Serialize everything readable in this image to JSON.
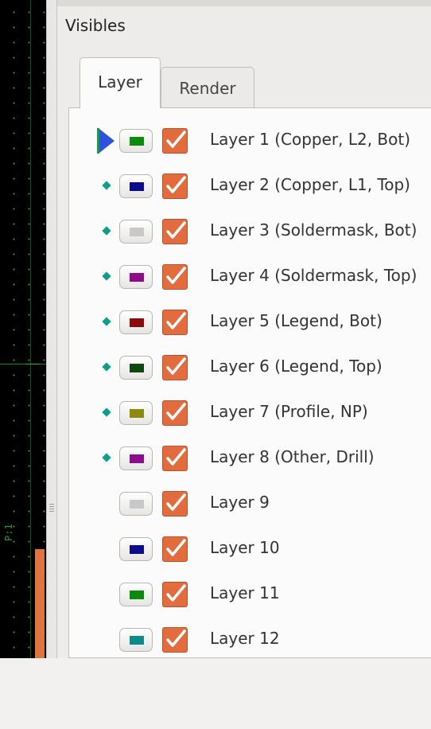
{
  "canvas": {
    "pin_label": "P:1"
  },
  "panel": {
    "title": "Visibles",
    "tabs": [
      {
        "label": "Layer",
        "active": true
      },
      {
        "label": "Render",
        "active": false
      }
    ]
  },
  "layers": [
    {
      "label": "Layer 1 (Copper, L2, Bot)",
      "color": "#0c8a0c",
      "marker": "arrow",
      "visible": true
    },
    {
      "label": "Layer 2 (Copper, L1, Top)",
      "color": "#0c0c8f",
      "marker": "diamond",
      "visible": true
    },
    {
      "label": "Layer 3 (Soldermask, Bot)",
      "color": "#c8c8c8",
      "marker": "diamond",
      "visible": true
    },
    {
      "label": "Layer 4 (Soldermask, Top)",
      "color": "#8c0c8c",
      "marker": "diamond",
      "visible": true
    },
    {
      "label": "Layer 5 (Legend, Bot)",
      "color": "#8c0c0c",
      "marker": "diamond",
      "visible": true
    },
    {
      "label": "Layer 6 (Legend, Top)",
      "color": "#0c4a0c",
      "marker": "diamond",
      "visible": true
    },
    {
      "label": "Layer 7 (Profile, NP)",
      "color": "#8c8c0c",
      "marker": "diamond",
      "visible": true
    },
    {
      "label": "Layer 8 (Other, Drill)",
      "color": "#8c0c8c",
      "marker": "diamond",
      "visible": true
    },
    {
      "label": "Layer 9",
      "color": "#c8c8c8",
      "marker": "none",
      "visible": true
    },
    {
      "label": "Layer 10",
      "color": "#0c0c8f",
      "marker": "none",
      "visible": true
    },
    {
      "label": "Layer 11",
      "color": "#0c8a0c",
      "marker": "none",
      "visible": true
    },
    {
      "label": "Layer 12",
      "color": "#0c8a8a",
      "marker": "none",
      "visible": true
    }
  ]
}
